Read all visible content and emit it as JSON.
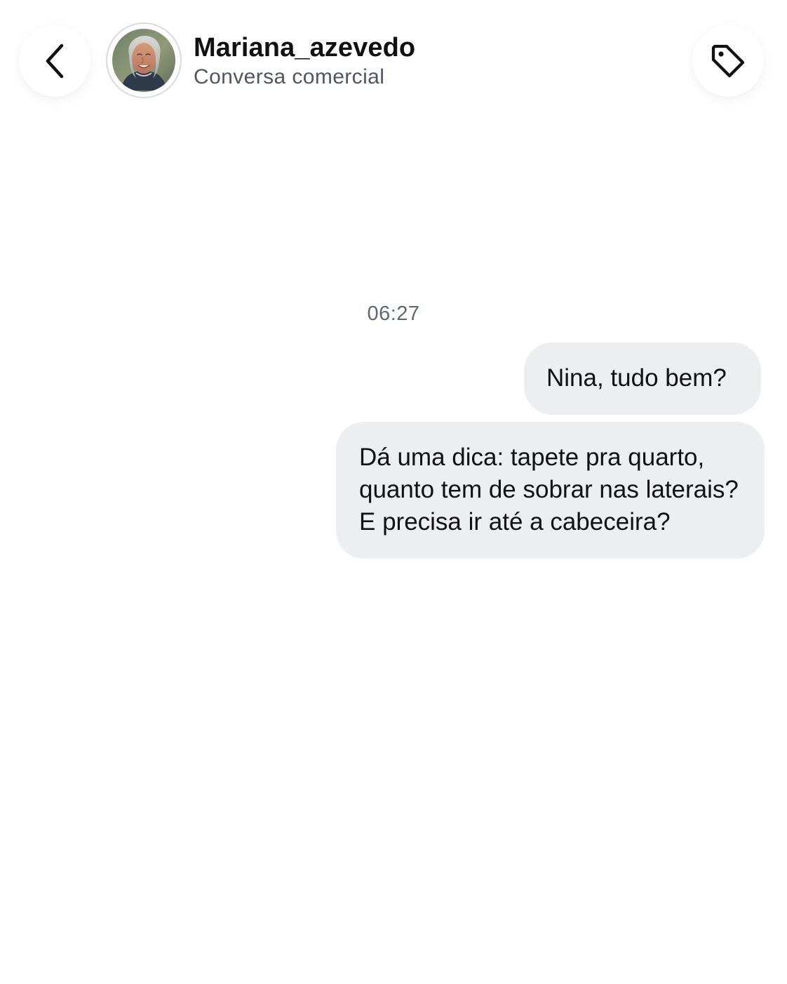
{
  "header": {
    "contact_name": "Mariana_azevedo",
    "subtitle": "Conversa comercial",
    "back_icon": "chevron-left-icon",
    "tag_icon": "tag-icon",
    "avatar": "avatar"
  },
  "conversation": {
    "timestamp": "06:27",
    "messages": [
      {
        "direction": "outgoing",
        "text": "Nina, tudo bem?"
      },
      {
        "direction": "outgoing",
        "text": "Dá uma dica: tapete pra quarto,\nquanto tem de sobrar nas laterais?\nE precisa ir até a cabeceira?"
      }
    ]
  },
  "colors": {
    "background": "#ffffff",
    "bubble": "#eceef2",
    "text_primary": "#111111",
    "text_secondary": "#4f5663"
  }
}
